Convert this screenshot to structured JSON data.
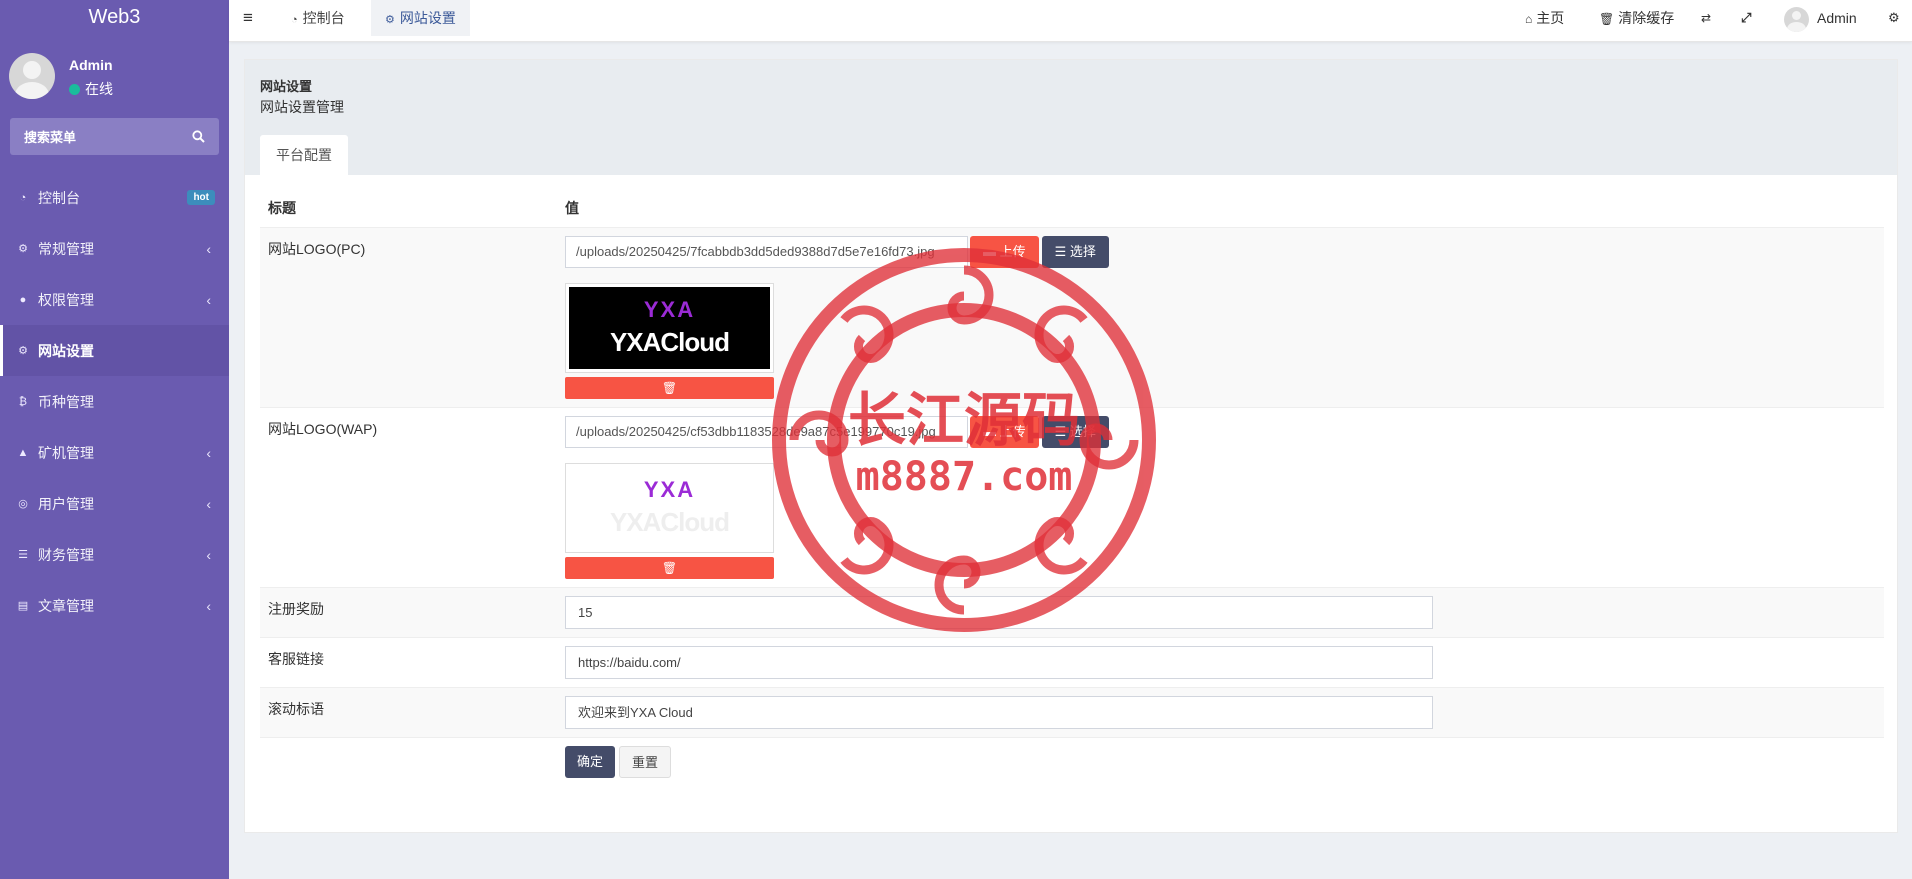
{
  "app": {
    "brand": "Web3"
  },
  "user": {
    "name": "Admin",
    "status": "在线"
  },
  "sidebar": {
    "search_placeholder": "搜索菜单",
    "items": [
      {
        "label": "控制台",
        "icon": "dashboard-icon",
        "badge": "hot"
      },
      {
        "label": "常规管理",
        "icon": "cogs-icon"
      },
      {
        "label": "权限管理",
        "icon": "users-icon"
      },
      {
        "label": "网站设置",
        "icon": "cogs-icon",
        "active": true
      },
      {
        "label": "币种管理",
        "icon": "bitcoin-icon"
      },
      {
        "label": "矿机管理",
        "icon": "binoculars-icon"
      },
      {
        "label": "用户管理",
        "icon": "instagram-icon"
      },
      {
        "label": "财务管理",
        "icon": "database-icon"
      },
      {
        "label": "文章管理",
        "icon": "book-icon"
      }
    ]
  },
  "header": {
    "tabs": [
      {
        "label": "控制台"
      },
      {
        "label": "网站设置"
      }
    ],
    "home": "主页",
    "clear_cache": "清除缓存",
    "user": "Admin"
  },
  "page": {
    "title": "网站设置",
    "subtitle": "网站设置管理",
    "tab": "平台配置",
    "col_title": "标题",
    "col_value": "值"
  },
  "rows": {
    "logo_pc": {
      "label": "网站LOGO(PC)",
      "value": "/uploads/20250425/7fcabbdb3dd5ded9388d7d5e7e16fd73.jpg",
      "upload": "上传",
      "choose": "选择",
      "preview_top": "YXA",
      "preview_bottom": "YXACloud"
    },
    "logo_wap": {
      "label": "网站LOGO(WAP)",
      "value": "/uploads/20250425/cf53dbb1183528de9a87c5e199770c19.jpg",
      "upload": "上传",
      "choose": "选择",
      "preview_top": "YXA",
      "preview_bottom": "YXACloud"
    },
    "reward": {
      "label": "注册奖励",
      "value": "15"
    },
    "service": {
      "label": "客服链接",
      "value": "https://baidu.com/"
    },
    "slogan": {
      "label": "滚动标语",
      "value": "欢迎来到YXA Cloud"
    }
  },
  "actions": {
    "ok": "确定",
    "reset": "重置"
  },
  "watermark": {
    "title": "长江源码",
    "url": "m8887.com"
  },
  "colors": {
    "sidebar": "#6a5bb0",
    "danger": "#f75444",
    "primary_dark": "#444c69",
    "online": "#1abc9c",
    "stamp": "#e03038"
  }
}
